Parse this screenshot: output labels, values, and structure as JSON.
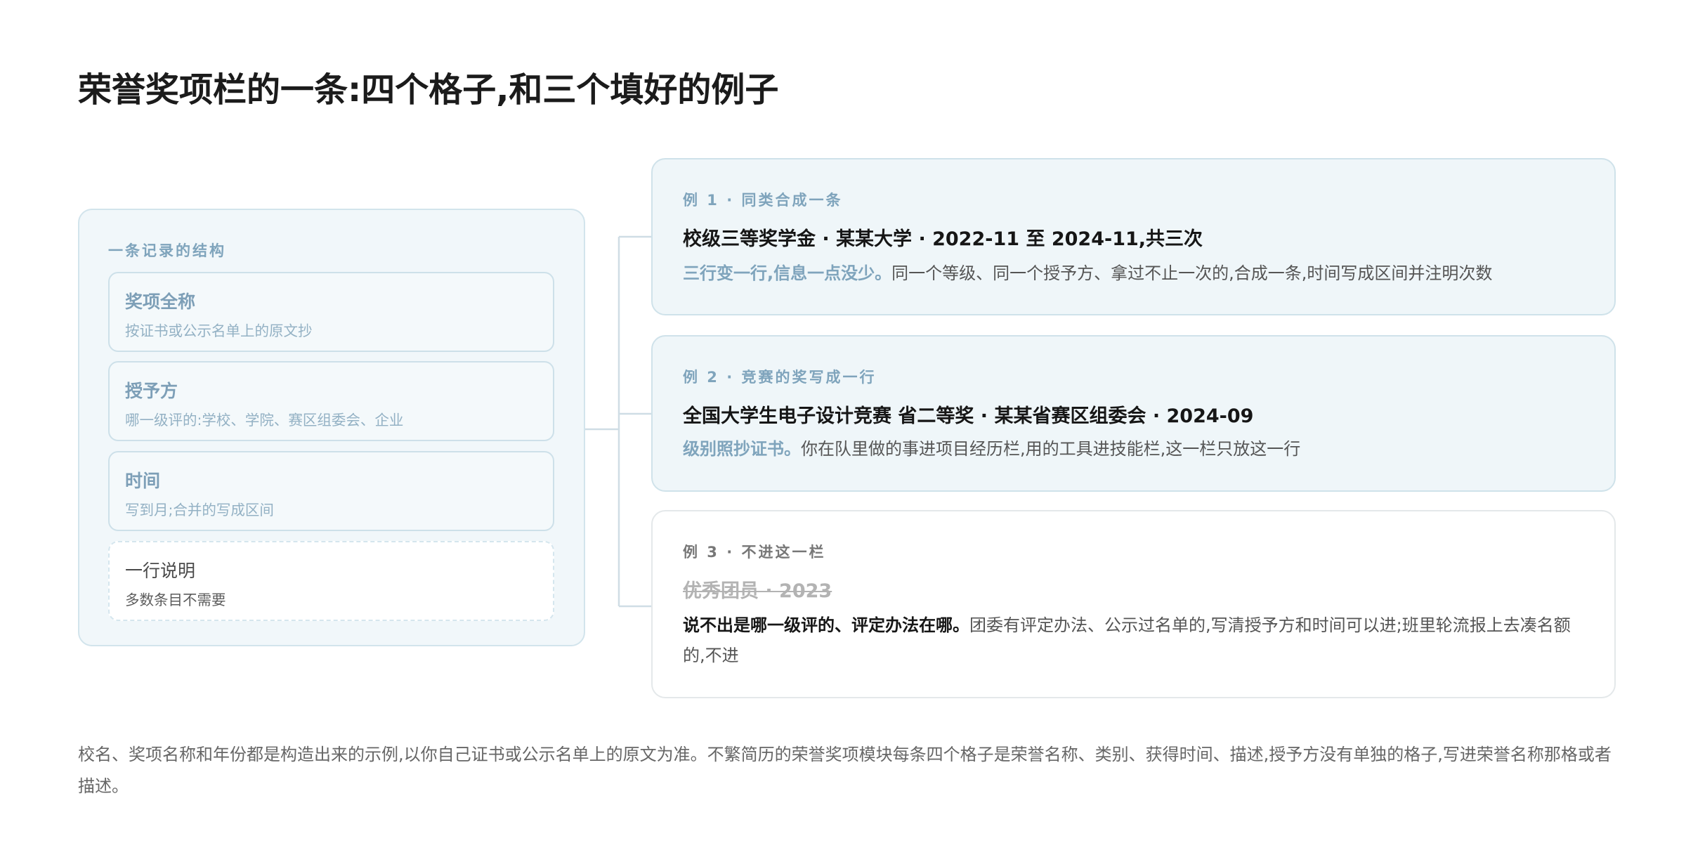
{
  "title": "荣誉奖项栏的一条:四个格子,和三个填好的例子",
  "structure": {
    "label": "一条记录的结构",
    "fields": [
      {
        "name": "奖项全称",
        "hint": "按证书或公示名单上的原文抄"
      },
      {
        "name": "授予方",
        "hint": "哪一级评的:学校、学院、赛区组委会、企业"
      },
      {
        "name": "时间",
        "hint": "写到月;合并的写成区间"
      },
      {
        "name": "一行说明",
        "hint": "多数条目不需要"
      }
    ]
  },
  "examples": [
    {
      "eyebrow": "例 1 · 同类合成一条",
      "entry": "校级三等奖学金 · 某某大学 · 2022-11 至 2024-11,共三次",
      "lead": "三行变一行,信息一点没少。",
      "note": "同一个等级、同一个授予方、拿过不止一次的,合成一条,时间写成区间并注明次数"
    },
    {
      "eyebrow": "例 2 · 竞赛的奖写成一行",
      "entry": "全国大学生电子设计竞赛 省二等奖 · 某某省赛区组委会 · 2024-09",
      "lead": "级别照抄证书。",
      "note": "你在队里做的事进项目经历栏,用的工具进技能栏,这一栏只放这一行"
    },
    {
      "eyebrow": "例 3 · 不进这一栏",
      "entry": "优秀团员 · 2023",
      "lead": "说不出是哪一级评的、评定办法在哪。",
      "note": "团委有评定办法、公示过名单的,写清授予方和时间可以进;班里轮流报上去凑名额的,不进"
    }
  ],
  "footnote": "校名、奖项名称和年份都是构造出来的示例,以你自己证书或公示名单上的原文为准。不繁简历的荣誉奖项模块每条四个格子是荣誉名称、类别、获得时间、描述,授予方没有单独的格子,写进荣誉名称那格或者描述。",
  "colors": {
    "accent": "#7fa4bc",
    "panel_bg": "#f1f7fa",
    "border": "#cfe2ea",
    "text": "#1b1b1b",
    "muted": "#666666"
  }
}
